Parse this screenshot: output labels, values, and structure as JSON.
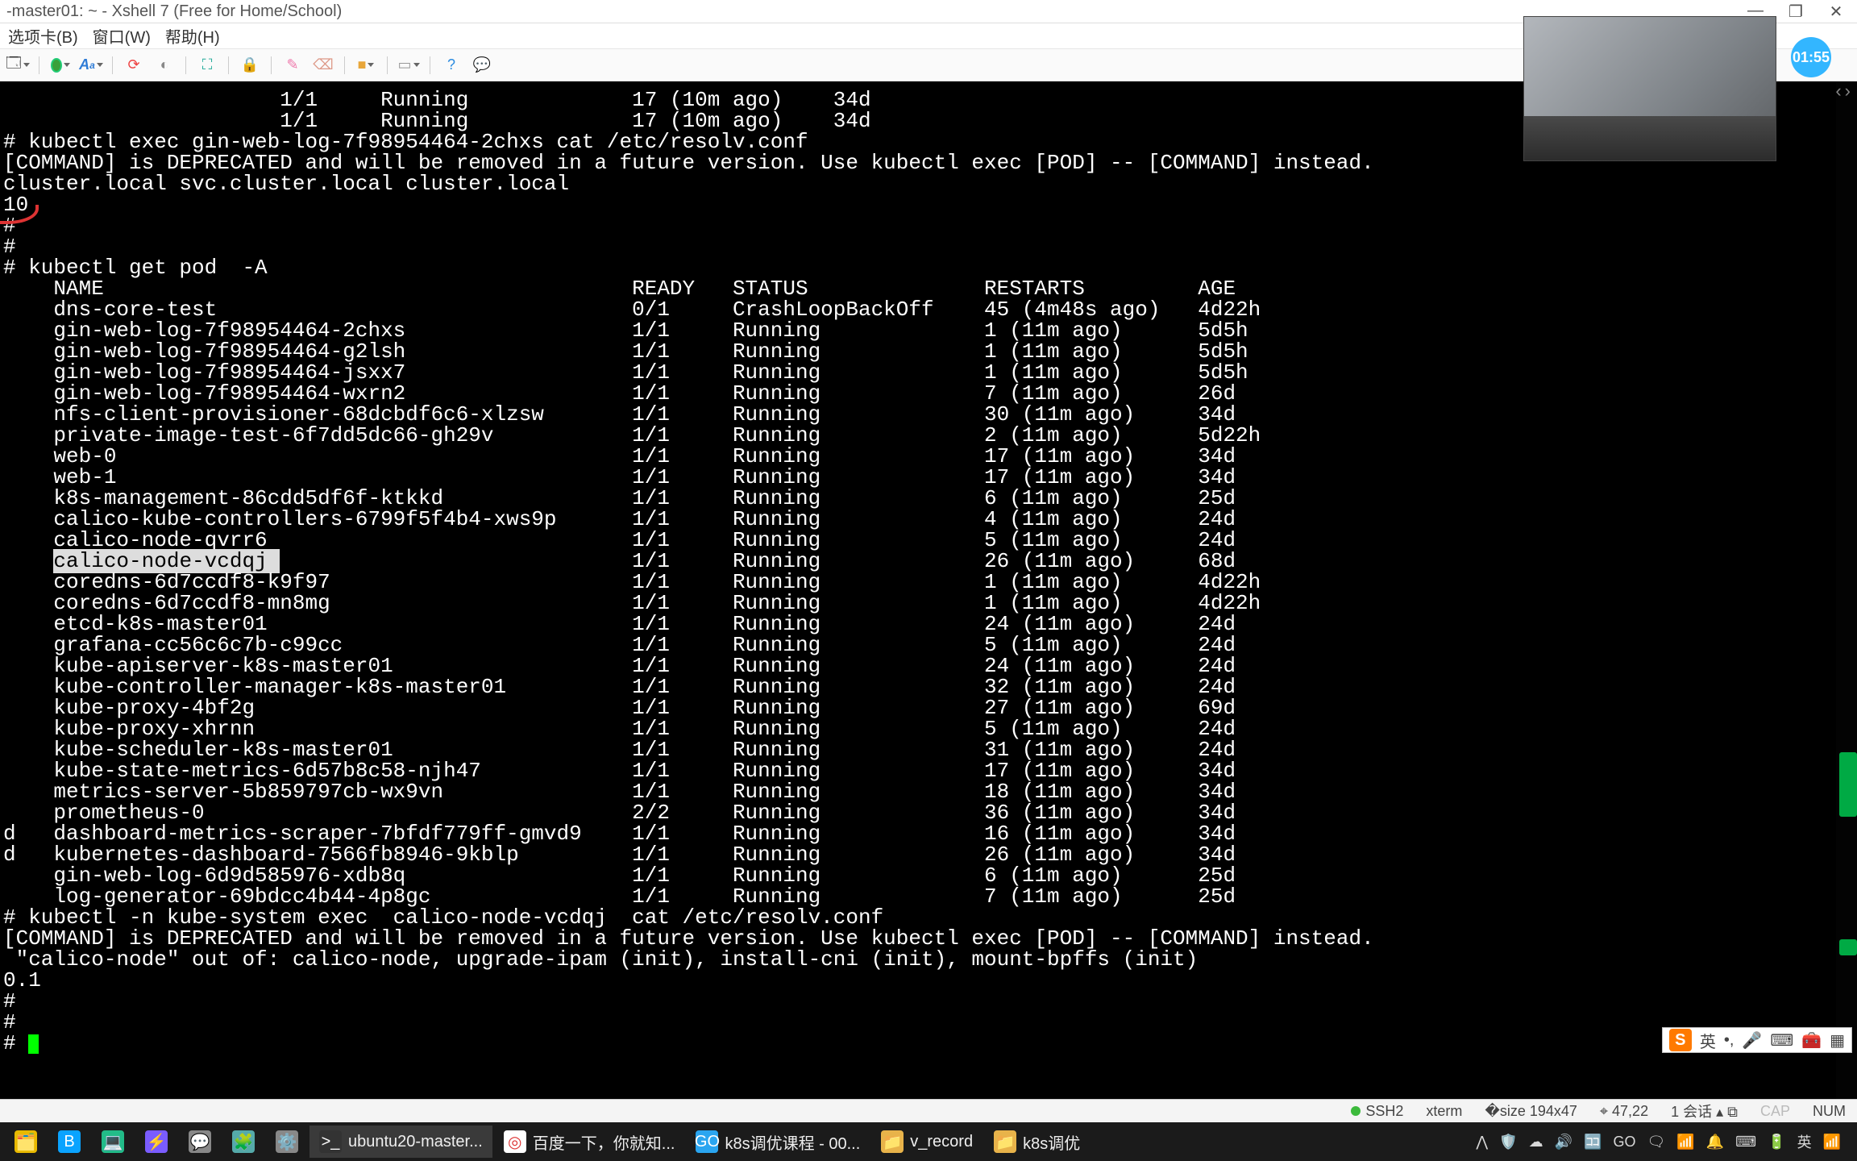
{
  "window": {
    "title": "-master01: ~ - Xshell 7 (Free for Home/School)"
  },
  "menu": {
    "tabs": "选项卡(B)",
    "window": "窗口(W)",
    "help": "帮助(H)"
  },
  "timer": "01:55",
  "nav": {
    "prev": "‹",
    "next": "›"
  },
  "terminal": {
    "intro": [
      "                      1/1     Running             17 (10m ago)    34d",
      "                      1/1     Running             17 (10m ago)    34d",
      "# kubectl exec gin-web-log-7f98954464-2chxs cat /etc/resolv.conf",
      "[COMMAND] is DEPRECATED and will be removed in a future version. Use kubectl exec [POD] -- [COMMAND] instead.",
      "cluster.local svc.cluster.local cluster.local",
      "10",
      "",
      "#",
      "#",
      "# kubectl get pod  -A"
    ],
    "header": "    NAME                                          READY   STATUS              RESTARTS         AGE",
    "pods": [
      {
        "n": "dns-core-test",
        "r": "0/1",
        "s": "CrashLoopBackOff",
        "rs": "45 (4m48s ago)",
        "a": "4d22h"
      },
      {
        "n": "gin-web-log-7f98954464-2chxs",
        "r": "1/1",
        "s": "Running",
        "rs": "1 (11m ago)",
        "a": "5d5h"
      },
      {
        "n": "gin-web-log-7f98954464-g2lsh",
        "r": "1/1",
        "s": "Running",
        "rs": "1 (11m ago)",
        "a": "5d5h"
      },
      {
        "n": "gin-web-log-7f98954464-jsxx7",
        "r": "1/1",
        "s": "Running",
        "rs": "1 (11m ago)",
        "a": "5d5h"
      },
      {
        "n": "gin-web-log-7f98954464-wxrn2",
        "r": "1/1",
        "s": "Running",
        "rs": "7 (11m ago)",
        "a": "26d"
      },
      {
        "n": "nfs-client-provisioner-68dcbdf6c6-xlzsw",
        "r": "1/1",
        "s": "Running",
        "rs": "30 (11m ago)",
        "a": "34d"
      },
      {
        "n": "private-image-test-6f7dd5dc66-gh29v",
        "r": "1/1",
        "s": "Running",
        "rs": "2 (11m ago)",
        "a": "5d22h"
      },
      {
        "n": "web-0",
        "r": "1/1",
        "s": "Running",
        "rs": "17 (11m ago)",
        "a": "34d"
      },
      {
        "n": "web-1",
        "r": "1/1",
        "s": "Running",
        "rs": "17 (11m ago)",
        "a": "34d"
      },
      {
        "n": "k8s-management-86cdd5df6f-ktkkd",
        "r": "1/1",
        "s": "Running",
        "rs": "6 (11m ago)",
        "a": "25d"
      },
      {
        "n": "calico-kube-controllers-6799f5f4b4-xws9p",
        "r": "1/1",
        "s": "Running",
        "rs": "4 (11m ago)",
        "a": "24d"
      },
      {
        "n": "calico-node-qvrr6",
        "r": "1/1",
        "s": "Running",
        "rs": "5 (11m ago)",
        "a": "24d"
      },
      {
        "n": "calico-node-vcdqj",
        "r": "1/1",
        "s": "Running",
        "rs": "26 (11m ago)",
        "a": "68d",
        "hl": true
      },
      {
        "n": "coredns-6d7ccdf8-k9f97",
        "r": "1/1",
        "s": "Running",
        "rs": "1 (11m ago)",
        "a": "4d22h"
      },
      {
        "n": "coredns-6d7ccdf8-mn8mg",
        "r": "1/1",
        "s": "Running",
        "rs": "1 (11m ago)",
        "a": "4d22h"
      },
      {
        "n": "etcd-k8s-master01",
        "r": "1/1",
        "s": "Running",
        "rs": "24 (11m ago)",
        "a": "24d"
      },
      {
        "n": "grafana-cc56c6c7b-c99cc",
        "r": "1/1",
        "s": "Running",
        "rs": "5 (11m ago)",
        "a": "24d"
      },
      {
        "n": "kube-apiserver-k8s-master01",
        "r": "1/1",
        "s": "Running",
        "rs": "24 (11m ago)",
        "a": "24d"
      },
      {
        "n": "kube-controller-manager-k8s-master01",
        "r": "1/1",
        "s": "Running",
        "rs": "32 (11m ago)",
        "a": "24d"
      },
      {
        "n": "kube-proxy-4bf2g",
        "r": "1/1",
        "s": "Running",
        "rs": "27 (11m ago)",
        "a": "69d"
      },
      {
        "n": "kube-proxy-xhrnn",
        "r": "1/1",
        "s": "Running",
        "rs": "5 (11m ago)",
        "a": "24d"
      },
      {
        "n": "kube-scheduler-k8s-master01",
        "r": "1/1",
        "s": "Running",
        "rs": "31 (11m ago)",
        "a": "24d"
      },
      {
        "n": "kube-state-metrics-6d57b8c58-njh47",
        "r": "1/1",
        "s": "Running",
        "rs": "17 (11m ago)",
        "a": "34d"
      },
      {
        "n": "metrics-server-5b859797cb-wx9vn",
        "r": "1/1",
        "s": "Running",
        "rs": "18 (11m ago)",
        "a": "34d"
      },
      {
        "n": "prometheus-0",
        "r": "2/2",
        "s": "Running",
        "rs": "36 (11m ago)",
        "a": "34d"
      },
      {
        "n": "dashboard-metrics-scraper-7bfdf779ff-gmvd9",
        "r": "1/1",
        "s": "Running",
        "rs": "16 (11m ago)",
        "a": "34d",
        "p": "d"
      },
      {
        "n": "kubernetes-dashboard-7566fb8946-9kblp",
        "r": "1/1",
        "s": "Running",
        "rs": "26 (11m ago)",
        "a": "34d",
        "p": "d"
      },
      {
        "n": "gin-web-log-6d9d585976-xdb8q",
        "r": "1/1",
        "s": "Running",
        "rs": "6 (11m ago)",
        "a": "25d"
      },
      {
        "n": "log-generator-69bdcc4b44-4p8gc",
        "r": "1/1",
        "s": "Running",
        "rs": "7 (11m ago)",
        "a": "25d"
      }
    ],
    "outro": [
      "# kubectl -n kube-system exec  calico-node-vcdqj  cat /etc/resolv.conf",
      "[COMMAND] is DEPRECATED and will be removed in a future version. Use kubectl exec [POD] -- [COMMAND] instead.",
      " \"calico-node\" out of: calico-node, upgrade-ipam (init), install-cni (init), mount-bpffs (init)",
      "0.1",
      "#",
      "#",
      "# "
    ]
  },
  "status": {
    "ssh": "SSH2",
    "term": "xterm",
    "size": "194x47",
    "pos": "47,22",
    "sess": "1 会话",
    "cap": "CAP",
    "num": "NUM"
  },
  "taskbar": {
    "items": [
      {
        "icon": "🗂️",
        "color": "#e8b900",
        "label": ""
      },
      {
        "icon": "B",
        "color": "#0aa3ff",
        "label": ""
      },
      {
        "icon": "💻",
        "color": "#2b8",
        "label": ""
      },
      {
        "icon": "⚡",
        "color": "#7a5cff",
        "label": ""
      },
      {
        "icon": "💬",
        "color": "#888",
        "label": ""
      },
      {
        "icon": "🧩",
        "color": "#5aa",
        "label": ""
      },
      {
        "icon": "⚙️",
        "color": "#888",
        "label": ""
      },
      {
        "icon": ">_",
        "color": "#333",
        "label": "ubuntu20-master..."
      },
      {
        "icon": "◎",
        "color": "#fff",
        "label": "百度一下，你就知..."
      },
      {
        "icon": "GO",
        "color": "#2aa5f0",
        "label": "k8s调优课程 - 00..."
      },
      {
        "icon": "📁",
        "color": "#e8b34a",
        "label": "v_record"
      },
      {
        "icon": "📁",
        "color": "#e8b34a",
        "label": "k8s调优"
      }
    ],
    "tray": [
      "⋀",
      "🛡️",
      "☁",
      "🔊",
      "🈁",
      "GO",
      "🗨",
      "📶",
      "🔔",
      "⌨",
      "🔋",
      "英",
      "📶"
    ]
  },
  "ime": {
    "lang": "英",
    "punct": "•,",
    "mic": "🎤",
    "kbd": "⌨",
    "tools": "🧰",
    "grid": "▦"
  }
}
